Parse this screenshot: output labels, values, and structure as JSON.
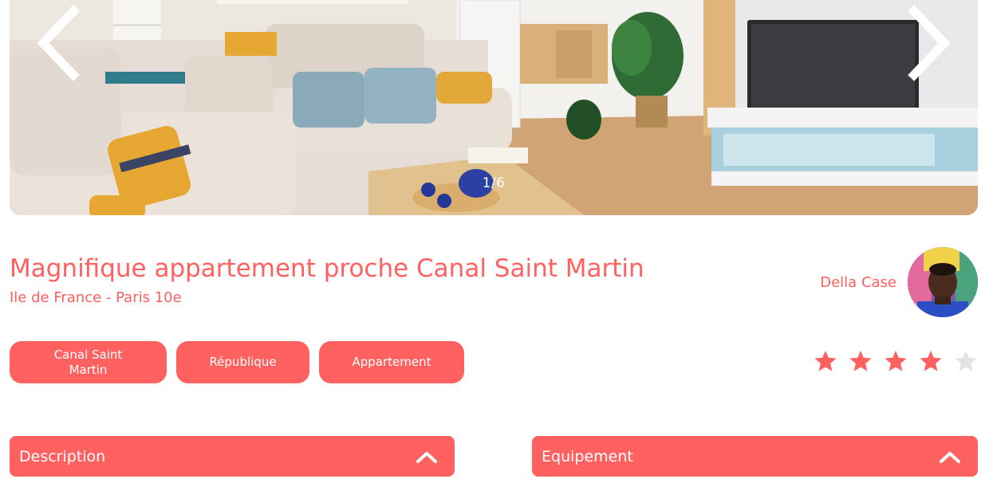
{
  "gallery": {
    "counter": "1/6",
    "prev_icon": "chevron-left-icon",
    "next_icon": "chevron-right-icon"
  },
  "listing": {
    "title": "Magnifique appartement proche Canal Saint Martin",
    "location": "Ile de France - Paris 10e"
  },
  "host": {
    "name": "Della Case"
  },
  "tags": [
    "Canal Saint Martin",
    "République",
    "Appartement"
  ],
  "rating": {
    "value": 4,
    "max": 5
  },
  "sections": {
    "description": {
      "title": "Description",
      "icon": "chevron-up-icon"
    },
    "equipment": {
      "title": "Equipement",
      "icon": "chevron-up-icon"
    }
  },
  "colors": {
    "accent": "#FF6060",
    "star_empty": "#E3E3E3",
    "white": "#FFFFFF"
  }
}
